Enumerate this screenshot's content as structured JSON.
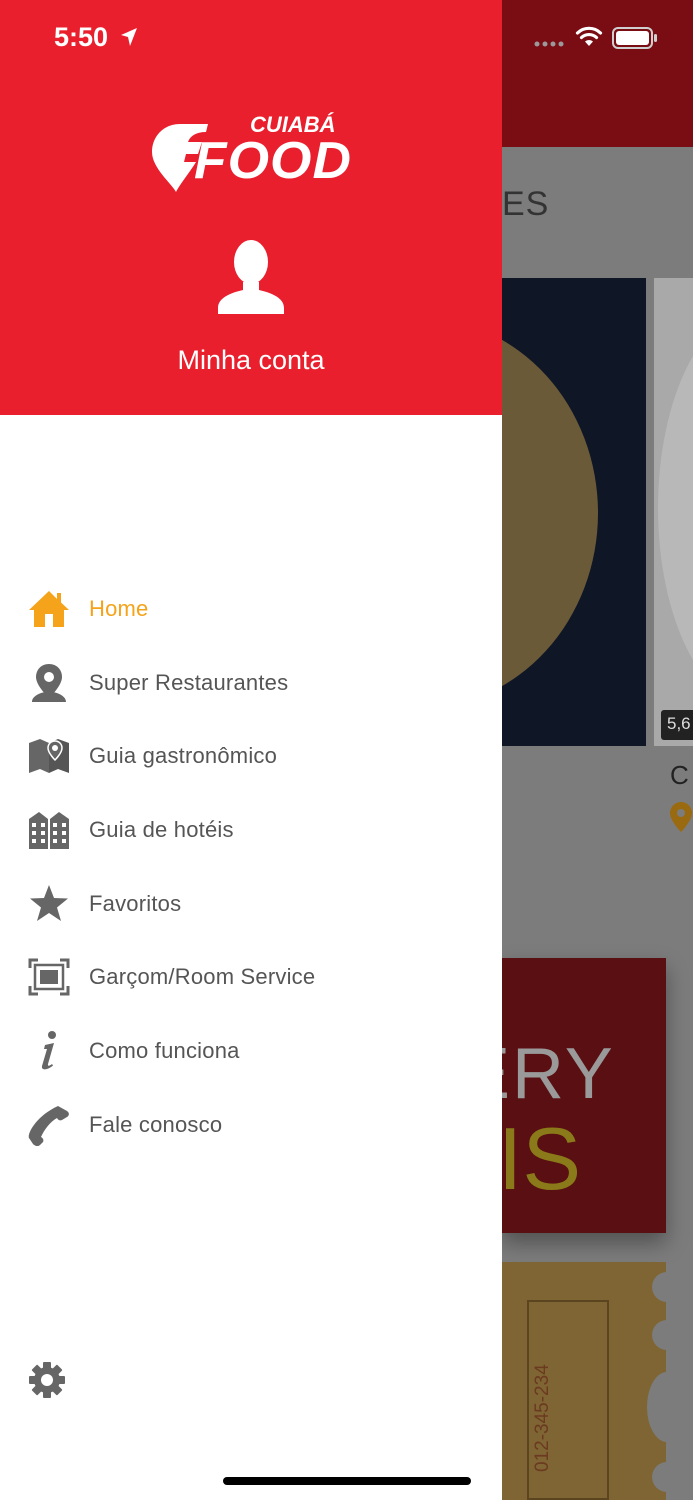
{
  "status_bar": {
    "time": "5:50"
  },
  "drawer": {
    "logo": {
      "word_top": "CUIABÁ",
      "word_main": "FOOD"
    },
    "account_label": "Minha conta",
    "menu": [
      {
        "label": "Home",
        "icon": "home-icon",
        "active": true
      },
      {
        "label": "Super Restaurantes",
        "icon": "map-pin-icon",
        "active": false
      },
      {
        "label": "Guia gastronômico",
        "icon": "map-icon",
        "active": false
      },
      {
        "label": "Guia de hotéis",
        "icon": "buildings-icon",
        "active": false
      },
      {
        "label": "Favoritos",
        "icon": "star-icon",
        "active": false
      },
      {
        "label": "Garçom/Room Service",
        "icon": "scan-frame-icon",
        "active": false
      },
      {
        "label": "Como funciona",
        "icon": "info-icon",
        "active": false
      },
      {
        "label": "Fale conosco",
        "icon": "phone-icon",
        "active": false
      }
    ],
    "settings_icon": "gear-icon"
  },
  "background": {
    "section_title_fragment": "ES",
    "price_fragment": "5,6",
    "card_title_fragment": "C",
    "banner_line1": "VERY",
    "banner_line2": "ATIS",
    "ticket_number": "012-345-234"
  },
  "colors": {
    "brand_red": "#ea1f2e",
    "active_orange": "#f5a31a",
    "menu_text": "#555555",
    "icon_gray": "#666666"
  }
}
